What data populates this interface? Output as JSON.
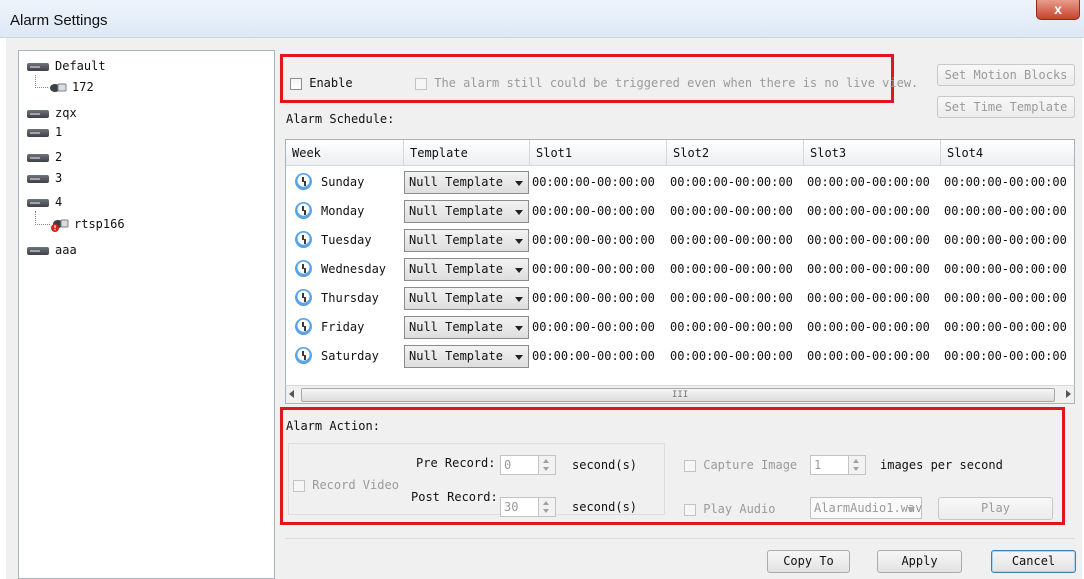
{
  "window": {
    "title": "Alarm Settings",
    "close_glyph": "x"
  },
  "tree": {
    "nodes": [
      {
        "label": "Default",
        "icon": "device-icon"
      },
      {
        "label": "172",
        "icon": "camera-icon"
      },
      {
        "label": "zqx",
        "icon": "device-icon"
      },
      {
        "label": "1",
        "icon": "device-icon"
      },
      {
        "label": "2",
        "icon": "device-icon"
      },
      {
        "label": "3",
        "icon": "device-icon"
      },
      {
        "label": "4",
        "icon": "device-icon"
      },
      {
        "label": "rtsp166",
        "icon": "camera-error-icon"
      },
      {
        "label": "aaa",
        "icon": "device-icon"
      }
    ]
  },
  "enable": {
    "label": "Enable",
    "trigger_label": "The alarm still could be triggered even when there is no live view."
  },
  "buttons": {
    "set_motion_blocks": "Set Motion Blocks",
    "set_time_template": "Set Time Template",
    "copy_to": "Copy To",
    "apply": "Apply",
    "cancel": "Cancel",
    "play": "Play"
  },
  "schedule": {
    "label": "Alarm Schedule:",
    "headers": [
      "Week",
      "Template",
      "Slot1",
      "Slot2",
      "Slot3",
      "Slot4"
    ],
    "rows": [
      {
        "day": "Sunday",
        "template": "Null Template",
        "slots": [
          "00:00:00-00:00:00",
          "00:00:00-00:00:00",
          "00:00:00-00:00:00",
          "00:00:00-00:00:00"
        ]
      },
      {
        "day": "Monday",
        "template": "Null Template",
        "slots": [
          "00:00:00-00:00:00",
          "00:00:00-00:00:00",
          "00:00:00-00:00:00",
          "00:00:00-00:00:00"
        ]
      },
      {
        "day": "Tuesday",
        "template": "Null Template",
        "slots": [
          "00:00:00-00:00:00",
          "00:00:00-00:00:00",
          "00:00:00-00:00:00",
          "00:00:00-00:00:00"
        ]
      },
      {
        "day": "Wednesday",
        "template": "Null Template",
        "slots": [
          "00:00:00-00:00:00",
          "00:00:00-00:00:00",
          "00:00:00-00:00:00",
          "00:00:00-00:00:00"
        ]
      },
      {
        "day": "Thursday",
        "template": "Null Template",
        "slots": [
          "00:00:00-00:00:00",
          "00:00:00-00:00:00",
          "00:00:00-00:00:00",
          "00:00:00-00:00:00"
        ]
      },
      {
        "day": "Friday",
        "template": "Null Template",
        "slots": [
          "00:00:00-00:00:00",
          "00:00:00-00:00:00",
          "00:00:00-00:00:00",
          "00:00:00-00:00:00"
        ]
      },
      {
        "day": "Saturday",
        "template": "Null Template",
        "slots": [
          "00:00:00-00:00:00",
          "00:00:00-00:00:00",
          "00:00:00-00:00:00",
          "00:00:00-00:00:00"
        ]
      }
    ],
    "scroll_grip": "III"
  },
  "action": {
    "label": "Alarm Action:",
    "record_video": "Record Video",
    "pre_record_label": "Pre Record:",
    "pre_record_value": "0",
    "post_record_label": "Post Record:",
    "post_record_value": "30",
    "unit": "second(s)",
    "capture_image": "Capture Image",
    "capture_value": "1",
    "capture_unit": "images per second",
    "play_audio": "Play Audio",
    "audio_file": "AlarmAudio1.wav"
  },
  "colors": {
    "highlight_border": "#e0161c",
    "accent": "#2a73c4"
  }
}
